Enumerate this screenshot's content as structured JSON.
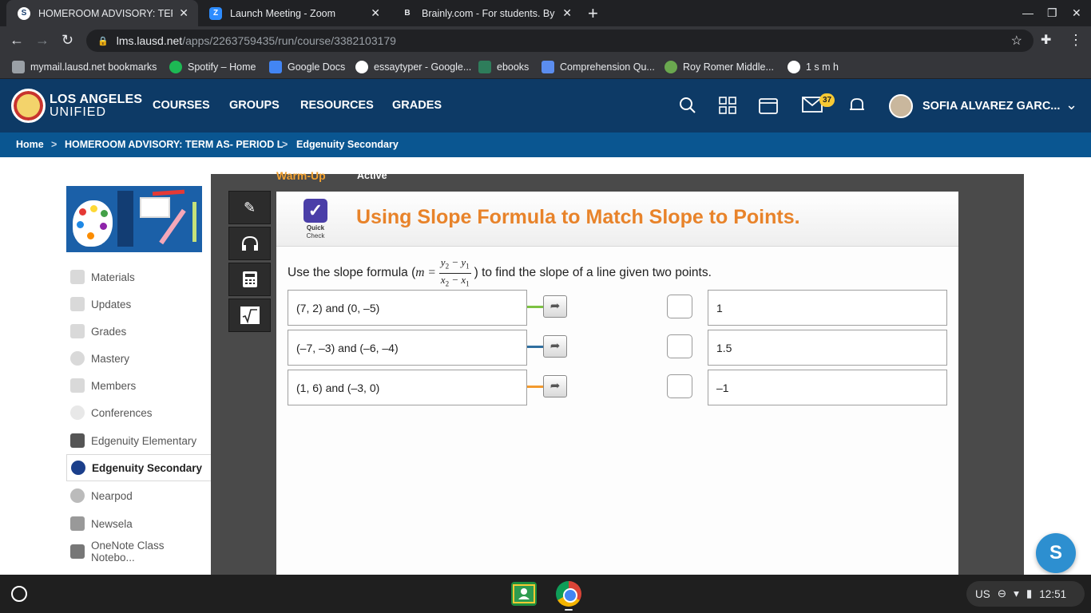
{
  "browser": {
    "tabs": [
      {
        "title": "HOMEROOM ADVISORY: TERM A",
        "favicon": "S"
      },
      {
        "title": "Launch Meeting - Zoom",
        "favicon": "Z"
      },
      {
        "title": "Brainly.com - For students. By st",
        "favicon": "B"
      }
    ],
    "url_host": "lms.lausd.net",
    "url_path": "/apps/2263759435/run/course/3382103179",
    "bookmarks": [
      "mymail.lausd.net bookmarks",
      "Spotify – Home",
      "Google Docs",
      "essaytyper - Google...",
      "ebooks",
      "Comprehension Qu...",
      "Roy Romer Middle...",
      "1 s m h"
    ]
  },
  "site": {
    "logo_line1": "LOS ANGELES",
    "logo_line2": "UNIFIED",
    "nav": [
      "COURSES",
      "GROUPS",
      "RESOURCES",
      "GRADES"
    ],
    "mail_count": "37",
    "user_name": "SOFIA ALVAREZ GARC...",
    "breadcrumb": [
      "Home",
      "HOMEROOM ADVISORY: TERM AS- PERIOD L",
      "Edgenuity Secondary"
    ],
    "breadcrumb_sep": ">"
  },
  "sidebar": {
    "items": [
      "Materials",
      "Updates",
      "Grades",
      "Mastery",
      "Members",
      "Conferences",
      "Edgenuity Elementary",
      "Edgenuity Secondary",
      "Nearpod",
      "Newsela",
      "OneNote Class Notebo..."
    ],
    "selected_index": 7
  },
  "activity": {
    "section_label": "Warm-Up",
    "status": "Active",
    "badge_label_1": "Quick",
    "badge_label_2": "Check",
    "title": "Using Slope Formula to Match Slope to Points.",
    "instruction_pre": "Use the slope formula (",
    "formula_lhs": "m =",
    "instruction_post": ") to find the slope of a line given two points.",
    "points": [
      "(7, 2) and (0, –5)",
      "(–7, –3) and (–6, –4)",
      "(1, 6) and (–3, 0)"
    ],
    "connector_colors": [
      "#7cc242",
      "#2f6f9f",
      "#f39a2e"
    ],
    "slopes": [
      "1",
      "1.5",
      "–1"
    ]
  },
  "fab_label": "S",
  "system": {
    "keyboard": "US",
    "time": "12:51"
  }
}
